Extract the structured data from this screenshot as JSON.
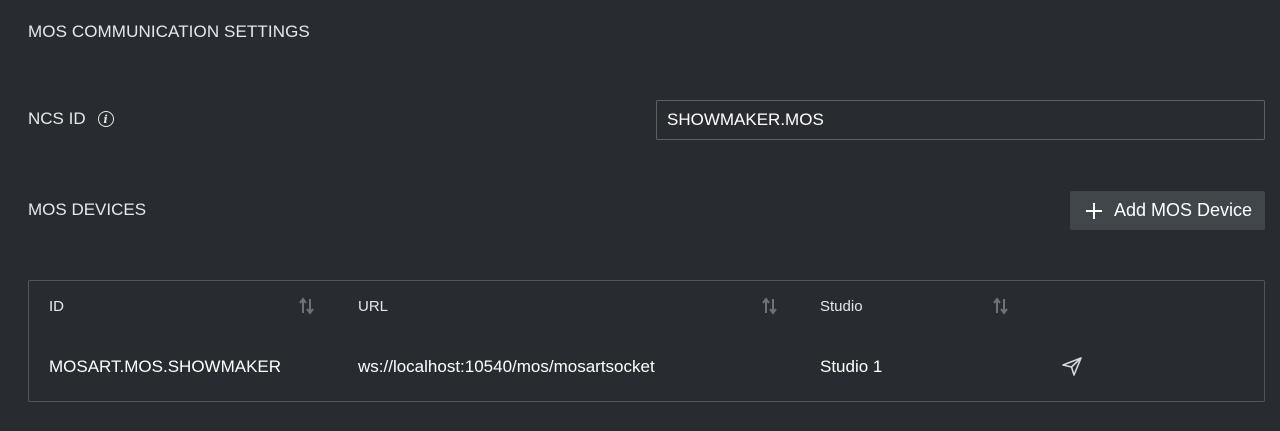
{
  "section": {
    "title": "MOS COMMUNICATION SETTINGS"
  },
  "ncs": {
    "label": "NCS ID",
    "info_icon": "info-icon",
    "value": "SHOWMAKER.MOS"
  },
  "devices": {
    "label": "MOS DEVICES",
    "add_button_label": "Add MOS Device",
    "add_icon": "plus-icon"
  },
  "table": {
    "columns": [
      {
        "label": "ID",
        "sort_icon": "sort-icon"
      },
      {
        "label": "URL",
        "sort_icon": "sort-icon"
      },
      {
        "label": "Studio",
        "sort_icon": "sort-icon"
      }
    ],
    "rows": [
      {
        "id": "MOSART.MOS.SHOWMAKER",
        "url": "ws://localhost:10540/mos/mosartsocket",
        "studio": "Studio 1",
        "action_icon": "send-icon"
      }
    ]
  },
  "colors": {
    "background": "#282b2f",
    "text": "#e6e8ea",
    "button_bg": "#41464b",
    "border": "#50555b"
  }
}
